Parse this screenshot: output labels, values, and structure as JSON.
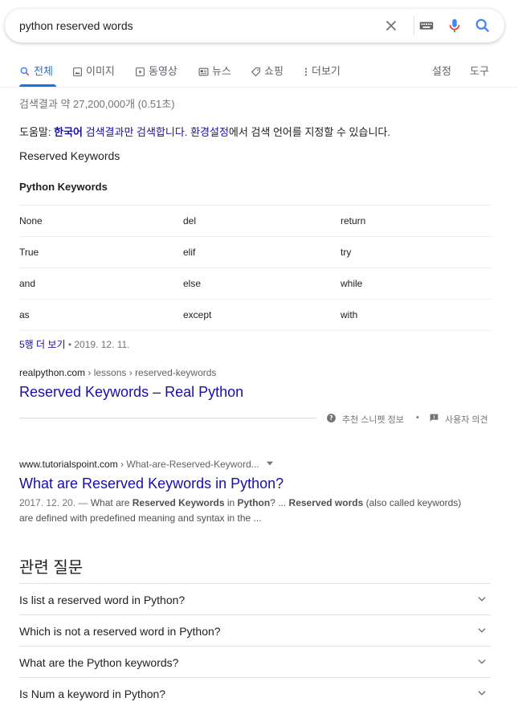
{
  "search": {
    "query": "python reserved words",
    "clear_label": "×"
  },
  "tabs": [
    {
      "label": "전체"
    },
    {
      "label": "이미지"
    },
    {
      "label": "동영상"
    },
    {
      "label": "뉴스"
    },
    {
      "label": "쇼핑"
    },
    {
      "label": "더보기"
    }
  ],
  "tools": {
    "settings": "설정",
    "tools": "도구"
  },
  "result_stats": "검색결과 약 27,200,000개 (0.51초)",
  "help": {
    "prefix": "도움말: ",
    "korean_link": "한국어",
    "middle": " 검색결과만 검색합니다. ",
    "settings_link": "환경설정",
    "suffix": "에서 검색 언어를 지정할 수 있습니다."
  },
  "snippet": {
    "heading": "Reserved Keywords",
    "table_title": "Python Keywords",
    "rows": [
      [
        "None",
        "del",
        "return"
      ],
      [
        "True",
        "elif",
        "try"
      ],
      [
        "and",
        "else",
        "while"
      ],
      [
        "as",
        "except",
        "with"
      ]
    ],
    "more_rows": "5행 더 보기",
    "date": " • 2019. 12. 11.",
    "cite_domain": "realpython.com",
    "cite_path": " › lessons › reserved-keywords",
    "title": "Reserved Keywords – Real Python",
    "about": "추천 스니펫 정보",
    "bullet": "•",
    "feedback": "사용자 의견"
  },
  "result2": {
    "cite_domain": "www.tutorialspoint.com",
    "cite_path": " › What-are-Reserved-Keyword...",
    "title": "What are Reserved Keywords in Python?",
    "date": "2017. 12. 20. — ",
    "desc_1": "What are ",
    "desc_b1": "Reserved Keywords",
    "desc_2": " in ",
    "desc_b2": "Python",
    "desc_3": "? ... ",
    "desc_b3": "Reserved words",
    "desc_4": " (also called keywords) are defined with predefined meaning and syntax in the ..."
  },
  "paa": {
    "title": "관련 질문",
    "items": [
      "Is list a reserved word in Python?",
      "Which is not a reserved word in Python?",
      "What are the Python keywords?",
      "Is Num a keyword in Python?"
    ]
  },
  "colors": {
    "link": "#1a0dab",
    "accent": "#1a73e8",
    "mic_red": "#ea4335"
  }
}
